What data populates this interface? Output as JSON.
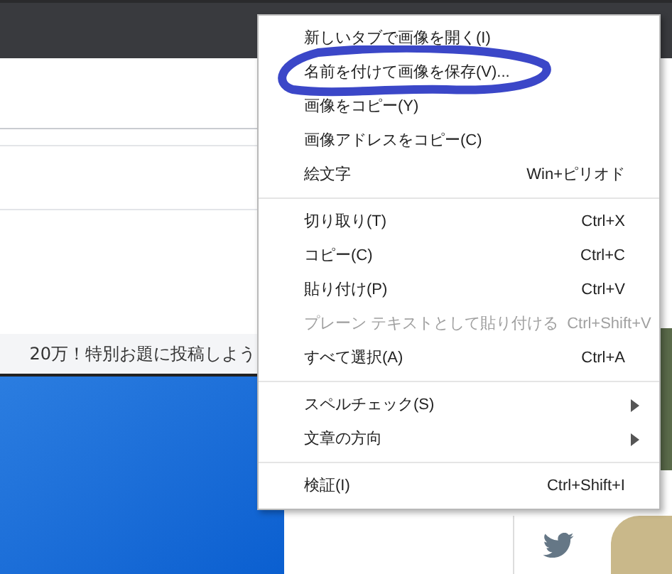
{
  "page": {
    "banner": "20万！特別お題に投稿しよう"
  },
  "context_menu": {
    "groups": [
      [
        {
          "label": "新しいタブで画像を開く(I)",
          "disabled": false,
          "submenu": false,
          "circled": false
        },
        {
          "label": "名前を付けて画像を保存(V)...",
          "disabled": false,
          "submenu": false,
          "circled": true
        },
        {
          "label": "画像をコピー(Y)",
          "disabled": false,
          "submenu": false,
          "circled": false
        },
        {
          "label": "画像アドレスをコピー(C)",
          "disabled": false,
          "submenu": false,
          "circled": false
        },
        {
          "label": "絵文字",
          "shortcut": "Win+ピリオド",
          "disabled": false,
          "submenu": false,
          "circled": false
        }
      ],
      [
        {
          "label": "切り取り(T)",
          "shortcut": "Ctrl+X",
          "disabled": false,
          "submenu": false,
          "circled": false
        },
        {
          "label": "コピー(C)",
          "shortcut": "Ctrl+C",
          "disabled": false,
          "submenu": false,
          "circled": false
        },
        {
          "label": "貼り付け(P)",
          "shortcut": "Ctrl+V",
          "disabled": false,
          "submenu": false,
          "circled": false
        },
        {
          "label": "プレーン テキストとして貼り付ける",
          "shortcut": "Ctrl+Shift+V",
          "disabled": true,
          "submenu": false,
          "circled": false
        },
        {
          "label": "すべて選択(A)",
          "shortcut": "Ctrl+A",
          "disabled": false,
          "submenu": false,
          "circled": false
        }
      ],
      [
        {
          "label": "スペルチェック(S)",
          "disabled": false,
          "submenu": true,
          "circled": false
        },
        {
          "label": "文章の方向",
          "disabled": false,
          "submenu": true,
          "circled": false
        }
      ],
      [
        {
          "label": "検証(I)",
          "shortcut": "Ctrl+Shift+I",
          "disabled": false,
          "submenu": false,
          "circled": false
        }
      ]
    ]
  }
}
